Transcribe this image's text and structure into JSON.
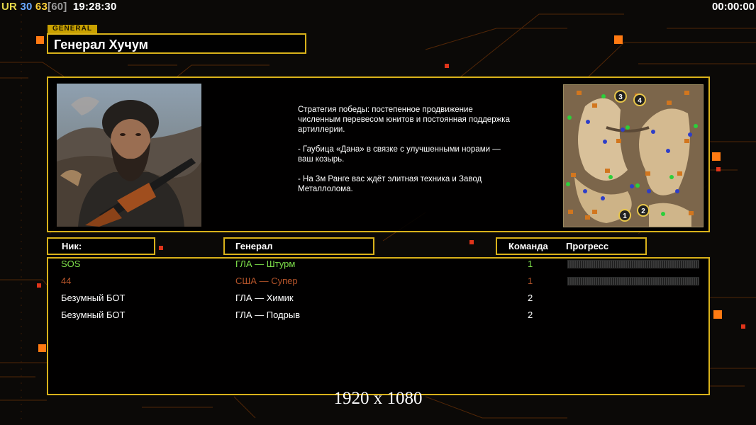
{
  "hud": {
    "ur": "UR",
    "ping": "30",
    "fps": "63",
    "fps_cap": "[60]",
    "clock": "19:28:30",
    "game_timer": "00:00:00"
  },
  "general": {
    "tag": "GENERAL",
    "name": "Генерал Хучум",
    "description": [
      "Стратегия победы: постепенное продвижение численным перевесом юнитов и постоянная поддержка артиллерии.",
      "- Гаубица «Дана» в связке с улучшенными норами — ваш козырь.",
      "- На 3м Ранге вас ждёт элитная техника и Завод Металлолома."
    ]
  },
  "minimap": {
    "start_positions": [
      "3",
      "4",
      "1",
      "2"
    ]
  },
  "columns": {
    "nick": "Ник:",
    "general": "Генерал",
    "team": "Команда",
    "progress": "Прогресс"
  },
  "players": [
    {
      "nick": "SOS",
      "general": "ГЛА — Штурм",
      "team": "1",
      "color": "#7ee04a",
      "has_progress": true
    },
    {
      "nick": "44",
      "general": "США — Супер",
      "team": "1",
      "color": "#b5542a",
      "has_progress": true
    },
    {
      "nick": "Безумный БОТ",
      "general": "ГЛА — Химик",
      "team": "2",
      "color": "#ffffff",
      "has_progress": false
    },
    {
      "nick": "Безумный БОТ",
      "general": "ГЛА — Подрыв",
      "team": "2",
      "color": "#ffffff",
      "has_progress": false
    }
  ],
  "resolution_label": "1920 x 1080",
  "colors": {
    "frame": "#d9b21a",
    "accent": "#ff7a12"
  }
}
